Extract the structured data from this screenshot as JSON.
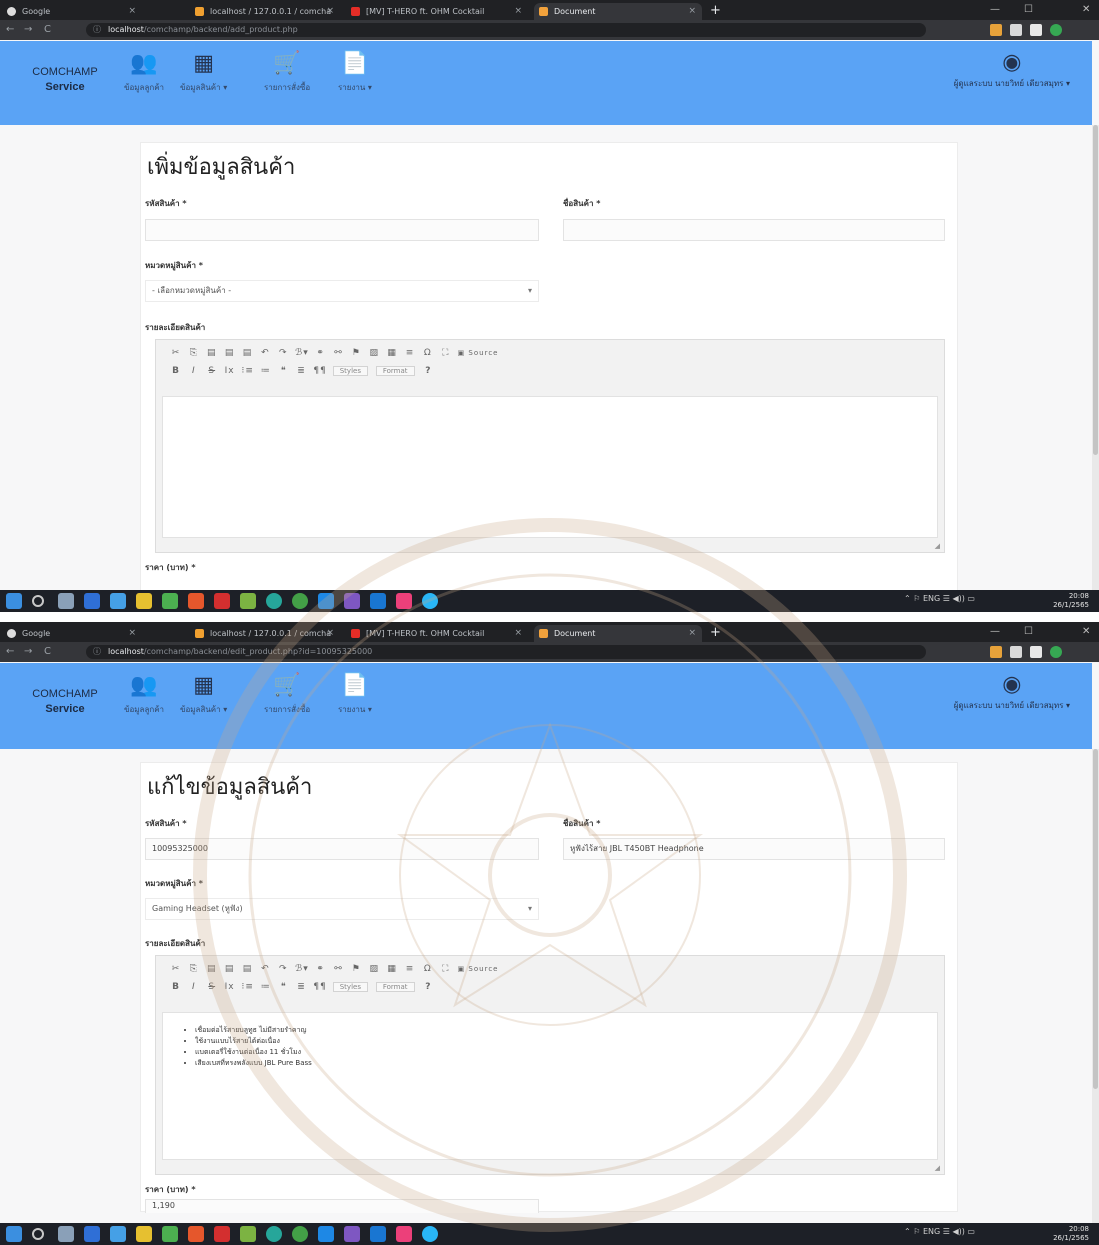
{
  "browser": {
    "tabs": [
      {
        "label": "Google"
      },
      {
        "label": "localhost / 127.0.0.1 / comcha"
      },
      {
        "label": "[MV] T-HERO ft. OHM Cocktail"
      },
      {
        "label": "Document"
      }
    ],
    "new_tab": "+",
    "window_controls": {
      "minimize": "—",
      "maximize": "☐",
      "close": "✕"
    },
    "nav": {
      "back": "←",
      "forward": "→",
      "reload": "C"
    },
    "url_host": "localhost",
    "url_rest_top": "/comchamp/backend/add_product.php",
    "url_rest_bottom": "/comchamp/backend/edit_product.php?id=10095325000"
  },
  "navbar": {
    "brand_line1": "COMCHAMP",
    "brand_line2": "Service",
    "items": [
      {
        "label": "ข้อมูลลูกค้า",
        "icon": "users-icon"
      },
      {
        "label": "ข้อมูลสินค้า ▾",
        "icon": "products-icon"
      },
      {
        "label": "รายการสั่งซื้อ",
        "icon": "cart-icon"
      },
      {
        "label": "รายงาน ▾",
        "icon": "report-icon"
      }
    ],
    "user_label": "ผู้ดูแลระบบ นายวิทย์ เดียวสมุทร ▾",
    "icons": {
      "users": "👥",
      "products": "▦",
      "cart": "🛒",
      "report": "📄",
      "user": "◉"
    }
  },
  "add_form": {
    "title": "เพิ่มข้อมูลสินค้า",
    "code_label": "รหัสสินค้า *",
    "code_value": "",
    "name_label": "ชื่อสินค้า *",
    "name_value": "",
    "category_label": "หมวดหมู่สินค้า *",
    "category_value": "- เลือกหมวดหมู่สินค้า -",
    "detail_label": "รายละเอียดสินค้า",
    "price_label": "ราคา (บาท) *"
  },
  "edit_form": {
    "title": "แก้ไขข้อมูลสินค้า",
    "code_label": "รหัสสินค้า *",
    "code_value": "10095325000",
    "name_label": "ชื่อสินค้า *",
    "name_value": "หูฟังไร้สาย JBL T450BT Headphone",
    "category_label": "หมวดหมู่สินค้า *",
    "category_value": "Gaming Headset (หูฟัง)",
    "detail_label": "รายละเอียดสินค้า",
    "bullets": [
      "เชื่อมต่อไร้สายบลูทูธ ไม่มีสายรำคาญ",
      "ใช้งานแบบไร้สายได้ต่อเนื่อง",
      "แบตเตอรี่ใช้งานต่อเนื่อง 11 ชั่วโมง",
      "เสียงเบสที่ทรงพลังแบบ JBL Pure Bass"
    ],
    "price_label": "ราคา (บาท) *",
    "price_value": "1,190"
  },
  "editor_toolbar": {
    "row1": [
      "✂",
      "⎘",
      "▤",
      "▤",
      "▤",
      "↶",
      "↷",
      "ℬ▾",
      "⚭",
      "⚯",
      "⚑",
      "▨",
      "▦",
      "≡",
      "Ω",
      "⛶",
      "▣ Source"
    ],
    "row2": [
      "B",
      "I",
      "S",
      "Ix",
      "⁝≡",
      "≔",
      "❝",
      "≣",
      "¶¶"
    ],
    "styles": "Styles",
    "format": "Format",
    "help": "?"
  },
  "taskbar": {
    "clock_time": "20:08",
    "clock_date": "26/1/2565",
    "tray": "⌃ ⚐ ENG ☰ ◀)) ▭"
  },
  "colors": {
    "navbar": "#5aa3f5",
    "tabstrip": "#202124",
    "taskbar": "#1d2027"
  }
}
